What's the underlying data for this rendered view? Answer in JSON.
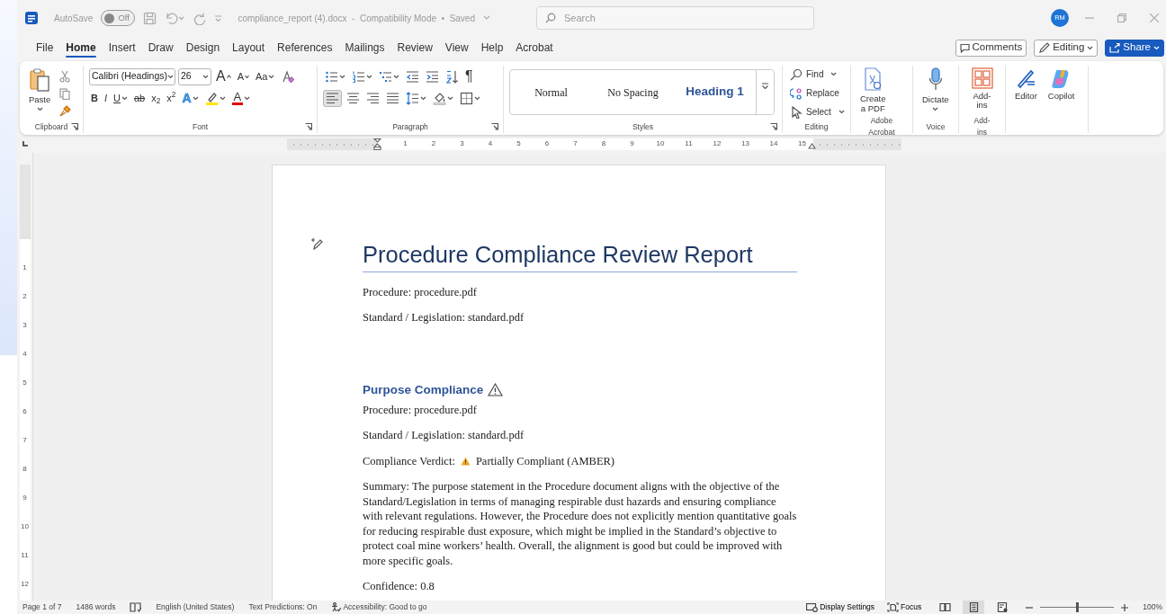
{
  "titlebar": {
    "autosave_label": "AutoSave",
    "autosave": {
      "on": false,
      "state_text": "Off"
    },
    "document_title": "compliance_report (4).docx  -  Compatibility Mode  •  Saved",
    "search": {
      "placeholder": "Search"
    },
    "avatar": "RM"
  },
  "menu_tabs": [
    {
      "label": "File",
      "selected": false
    },
    {
      "label": "Home",
      "selected": true
    },
    {
      "label": "Insert",
      "selected": false
    },
    {
      "label": "Draw",
      "selected": false
    },
    {
      "label": "Design",
      "selected": false
    },
    {
      "label": "Layout",
      "selected": false
    },
    {
      "label": "References",
      "selected": false
    },
    {
      "label": "Mailings",
      "selected": false
    },
    {
      "label": "Review",
      "selected": false
    },
    {
      "label": "View",
      "selected": false
    },
    {
      "label": "Help",
      "selected": false
    },
    {
      "label": "Acrobat",
      "selected": false
    }
  ],
  "header_buttons": {
    "comments": "Comments",
    "editing": "Editing",
    "share": "Share"
  },
  "ribbon": {
    "clipboard": {
      "label": "Clipboard",
      "paste": "Paste"
    },
    "font": {
      "label": "Font",
      "font_name": "Calibri (Headings)",
      "font_size": "26",
      "grow": "A",
      "shrink": "A",
      "change_case": "Aa",
      "bold": "B",
      "italic": "I",
      "underline": "U",
      "strikethrough": "ab",
      "subscript": "x$_{2}$",
      "superscript": "x$^{2}$",
      "text_effects": "A",
      "font_color": "A"
    },
    "paragraph": {
      "label": "Paragraph",
      "show_marks": "¶",
      "align_buttons": [
        {
          "kind": "left",
          "selected": true
        },
        {
          "kind": "center",
          "selected": false
        },
        {
          "kind": "right",
          "selected": false
        },
        {
          "kind": "justify",
          "selected": false
        }
      ]
    },
    "styles": {
      "label": "Styles",
      "items": [
        {
          "kind": "normal",
          "label": "Normal"
        },
        {
          "kind": "no-spacing",
          "label": "No Spacing"
        },
        {
          "kind": "heading",
          "label": "Heading 1"
        }
      ]
    },
    "editing": {
      "label": "Editing",
      "items": [
        {
          "kind": "find",
          "label": "Find",
          "dropdown": true
        },
        {
          "kind": "replace",
          "label": "Replace",
          "dropdown": false
        },
        {
          "kind": "select",
          "label": "Select",
          "dropdown": true
        }
      ]
    },
    "acrobat": {
      "label": "Adobe Acrobat",
      "button": [
        "Create",
        "a PDF"
      ]
    },
    "voice": {
      "label": "Voice",
      "button": "Dictate"
    },
    "addins": {
      "label": "Add-ins",
      "button": "Add-ins"
    },
    "tools": [
      "Editor",
      "Copilot"
    ]
  },
  "horizontal_ruler": {
    "numbers": [
      "1",
      "2",
      "3",
      "4",
      "5",
      "6",
      "7",
      "8",
      "9",
      "10",
      "11",
      "12",
      "13",
      "14",
      "15"
    ]
  },
  "vertical_ruler": {
    "numbers": [
      "1",
      "2",
      "3",
      "4",
      "5",
      "6",
      "7",
      "8",
      "9",
      "10",
      "11",
      "12"
    ]
  },
  "document": {
    "title": "Procedure Compliance Review Report",
    "blocks": [
      {
        "kind": "para",
        "text": "Procedure: procedure.pdf"
      },
      {
        "kind": "para",
        "text": "Standard / Legislation: standard.pdf"
      },
      {
        "kind": "heading",
        "text": "Purpose Compliance",
        "warning": true
      },
      {
        "kind": "para",
        "text": "Procedure: procedure.pdf"
      },
      {
        "kind": "para",
        "text": "Standard / Legislation: standard.pdf"
      },
      {
        "kind": "verdict",
        "label": "Compliance Verdict:",
        "value": "Partially Compliant (AMBER)"
      },
      {
        "kind": "para",
        "text": "Summary: The purpose statement in the Procedure document aligns with the objective of the Standard/Legislation in terms of managing respirable dust hazards and ensuring compliance with relevant regulations. However, the Procedure does not explicitly mention quantitative goals for reducing respirable dust exposure, which might be implied in the Standard’s objective to protect coal mine workers’ health. Overall, the alignment is good but could be improved with more specific goals."
      },
      {
        "kind": "para",
        "text": "Confidence: 0.8"
      }
    ]
  },
  "status_bar": {
    "page": "Page 1 of 7",
    "words": "1486 words",
    "language": "English (United States)",
    "predictions": "Text Predictions: On",
    "accessibility": "Accessibility: Good to go",
    "display_settings": "Display Settings",
    "focus": "Focus",
    "views": [
      {
        "kind": "read",
        "selected": false
      },
      {
        "kind": "print",
        "selected": true
      },
      {
        "kind": "web",
        "selected": false
      }
    ],
    "zoom": {
      "level": 0.5,
      "text": "100%"
    }
  }
}
